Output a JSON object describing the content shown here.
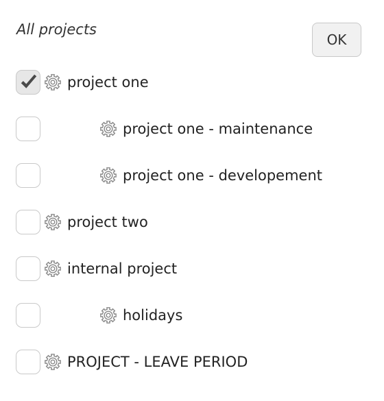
{
  "header": {
    "title": "All projects",
    "ok_label": "OK"
  },
  "icons": {
    "settings": "gear-icon",
    "check": "checkmark-icon"
  },
  "projects": [
    {
      "label": "project one",
      "level": 0,
      "checked": true
    },
    {
      "label": "project one - maintenance",
      "level": 1,
      "checked": false
    },
    {
      "label": "project one - developement",
      "level": 1,
      "checked": false
    },
    {
      "label": "project two",
      "level": 0,
      "checked": false
    },
    {
      "label": "internal project",
      "level": 0,
      "checked": false
    },
    {
      "label": "holidays",
      "level": 1,
      "checked": false
    },
    {
      "label": "PROJECT - LEAVE PERIOD",
      "level": 0,
      "checked": false
    }
  ],
  "colors": {
    "gear": "#8a8a8a",
    "checkmark": "#4a4a4a",
    "checkbox_border": "#c9c9c9"
  }
}
